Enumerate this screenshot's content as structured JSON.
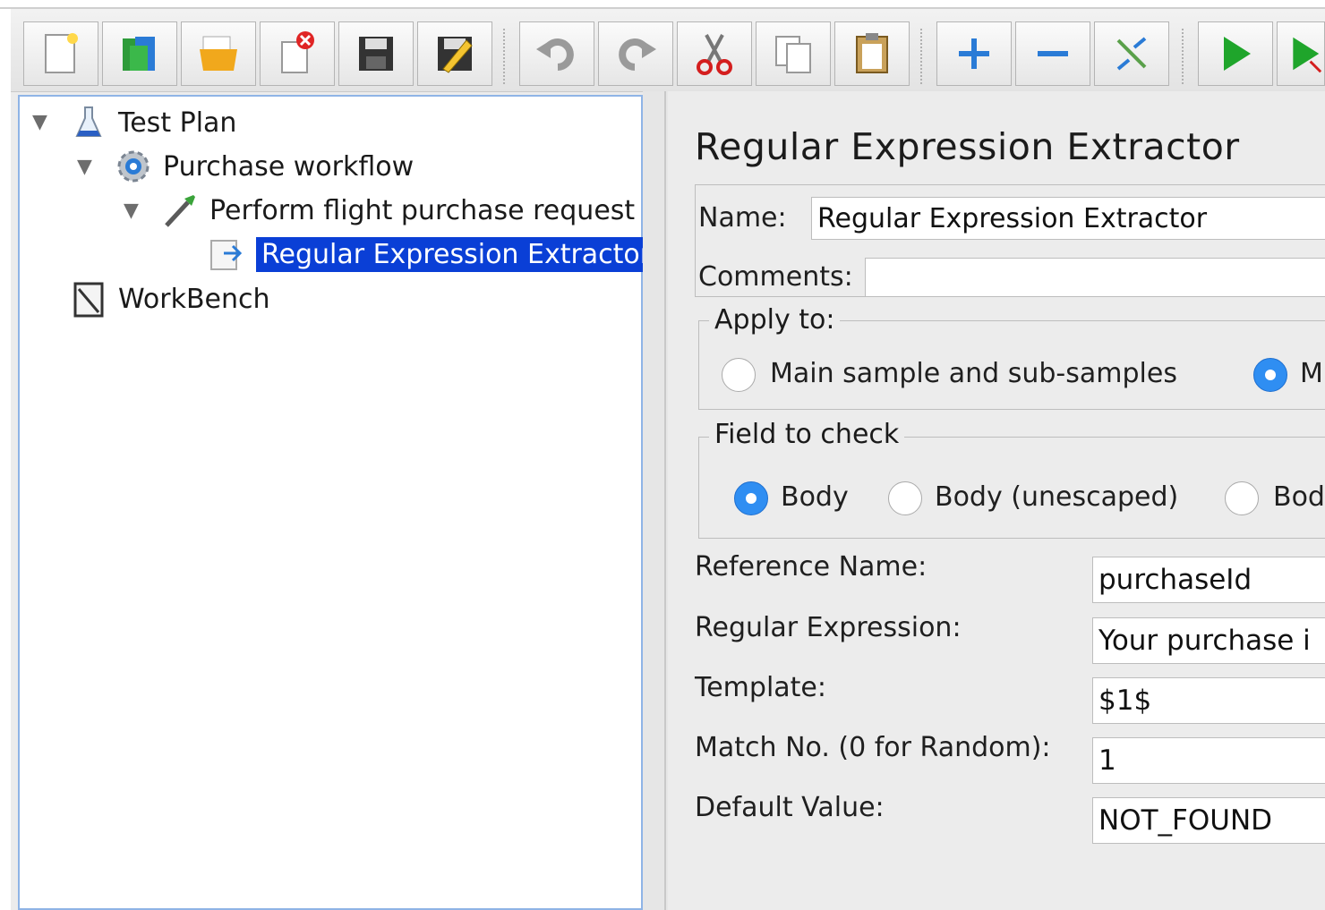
{
  "toolbar": {
    "buttons": [
      "new-icon",
      "templates-icon",
      "open-icon",
      "close-icon",
      "save-icon",
      "save-as-icon",
      "undo-icon",
      "redo-icon",
      "cut-icon",
      "copy-icon",
      "paste-icon",
      "expand-icon",
      "collapse-icon",
      "toggle-icon",
      "start-icon",
      "start-no-pause-icon"
    ]
  },
  "tree": {
    "items": [
      {
        "label": "Test Plan"
      },
      {
        "label": "Purchase workflow"
      },
      {
        "label": "Perform flight purchase request"
      },
      {
        "label": "Regular Expression Extractor"
      },
      {
        "label": "WorkBench"
      }
    ]
  },
  "panel": {
    "title": "Regular Expression Extractor",
    "name_label": "Name:",
    "name_value": "Regular Expression Extractor",
    "comments_label": "Comments:",
    "comments_value": "",
    "apply_to": {
      "legend": "Apply to:",
      "options": [
        "Main sample and sub-samples",
        "M"
      ],
      "selected": 1
    },
    "field_to_check": {
      "legend": "Field to check",
      "options": [
        "Body",
        "Body (unescaped)",
        "Bod"
      ],
      "selected": 0
    },
    "reference_name_label": "Reference Name:",
    "reference_name_value": "purchaseId",
    "regex_label": "Regular Expression:",
    "regex_value": "Your purchase i",
    "template_label": "Template:",
    "template_value": "$1$",
    "match_no_label": "Match No. (0 for Random):",
    "match_no_value": "1",
    "default_value_label": "Default Value:",
    "default_value_value": "NOT_FOUND"
  },
  "colors": {
    "selection": "#0a3fd6",
    "radio_on": "#2f8ef2",
    "tree_border": "#8fb4e6"
  }
}
